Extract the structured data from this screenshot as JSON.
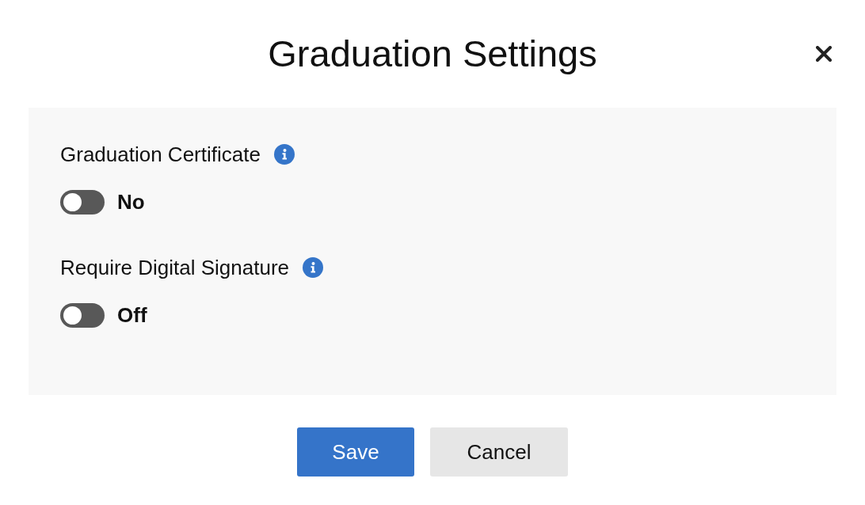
{
  "dialog": {
    "title": "Graduation Settings"
  },
  "settings": [
    {
      "label": "Graduation Certificate",
      "info": true,
      "on": false,
      "state_text": "No"
    },
    {
      "label": "Require Digital Signature",
      "info": true,
      "on": false,
      "state_text": "Off"
    }
  ],
  "buttons": [
    {
      "label": "Save",
      "kind": "primary"
    },
    {
      "label": "Cancel",
      "kind": "secondary"
    }
  ]
}
